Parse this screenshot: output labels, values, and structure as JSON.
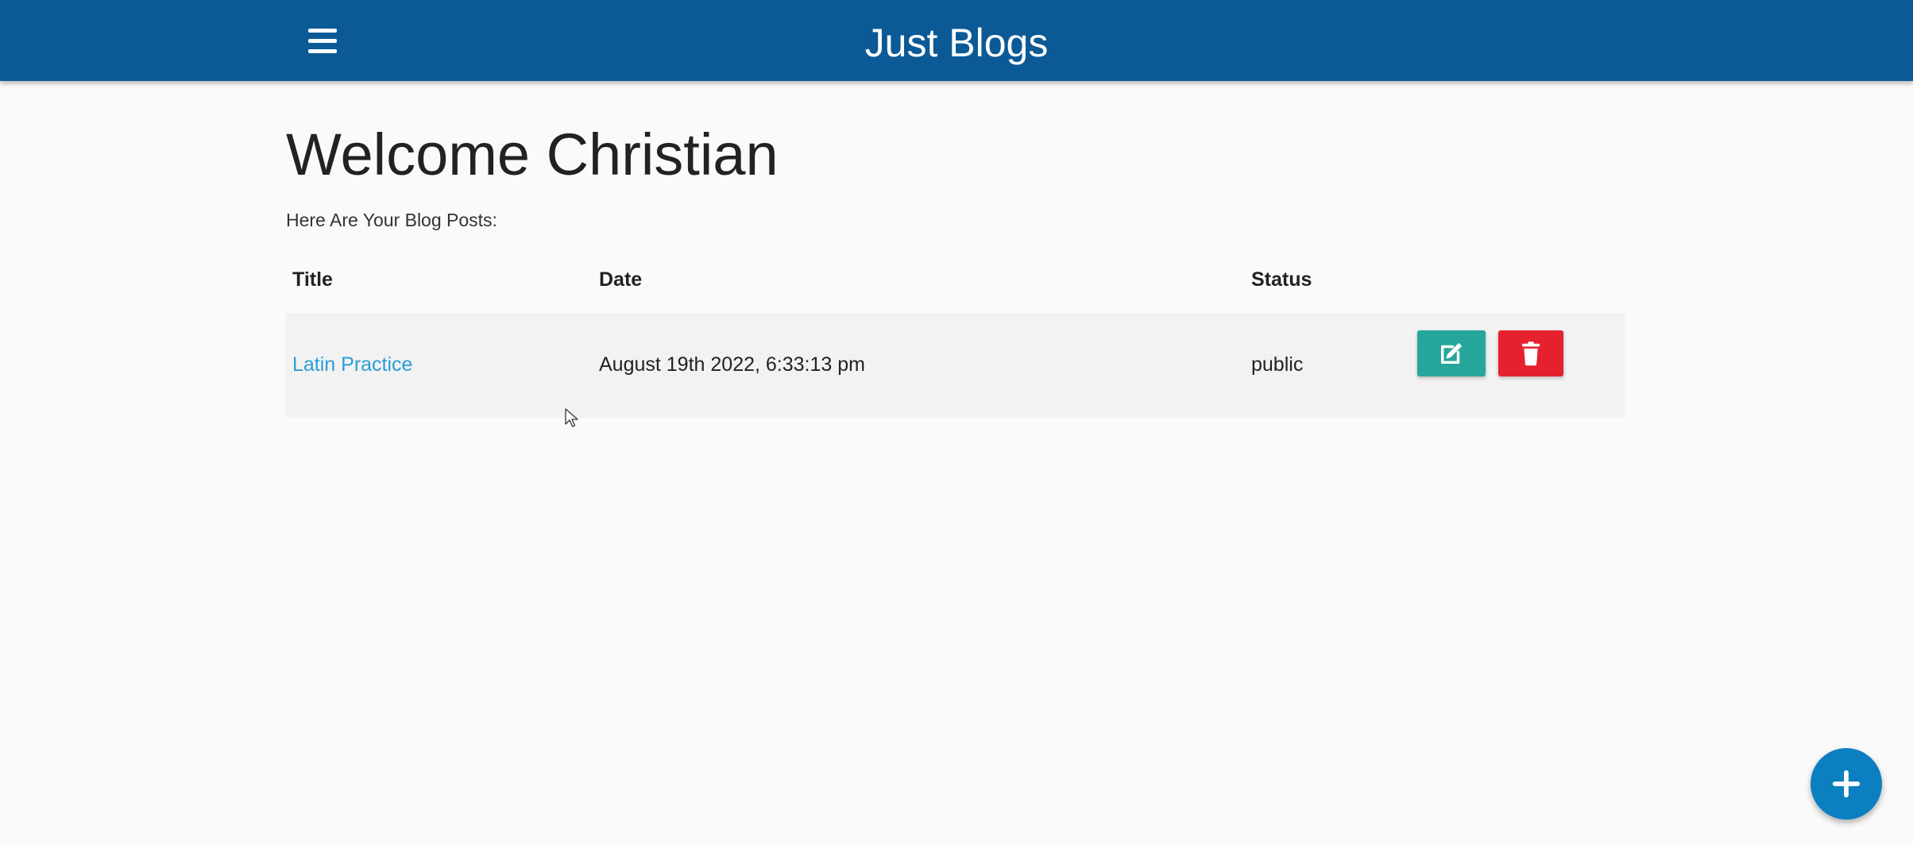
{
  "header": {
    "brand": "Just Blogs",
    "menu_icon": "hamburger-menu-icon",
    "background": "#0b5a96"
  },
  "main": {
    "title": "Welcome Christian",
    "subtitle": "Here Are Your Blog Posts:"
  },
  "table": {
    "columns": [
      "Title",
      "Date",
      "Status"
    ],
    "rows": [
      {
        "title": "Latin Practice",
        "date": "August 19th 2022, 6:33:13 pm",
        "status": "public",
        "edit_icon": "edit-icon",
        "delete_icon": "trash-icon"
      }
    ]
  },
  "fab": {
    "icon": "plus-icon",
    "color": "#0c7fc0"
  },
  "colors": {
    "link": "#2a9ed6",
    "edit_button": "#26a69a",
    "delete_button": "#e5212f"
  }
}
